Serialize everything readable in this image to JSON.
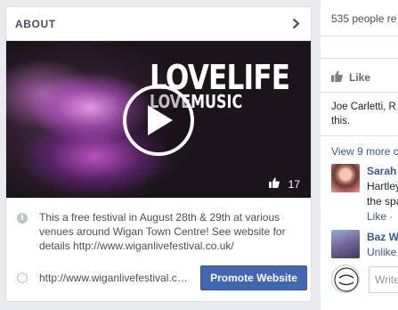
{
  "about": {
    "title": "ABOUT",
    "video": {
      "brand_line1": "LOVELIFE",
      "brand_line2": "LOVEMUSIC",
      "like_count": "17"
    },
    "description": "This a free festival in August 28th & 29th at various venues around Wigan Town Centre! See website for details http://www.wiganlivefestival.co.uk/",
    "website_url": "http://www.wiganlivefestival.co.uk/",
    "promote_label": "Promote Website"
  },
  "right_column": {
    "people_count_text": "535 people re",
    "like_label": "Like",
    "reactors_line1": "Joe Carletti, R",
    "reactors_line2": "this.",
    "view_more": "View 9 more c",
    "comments": [
      {
        "name": "Sarah",
        "line2": "Hartley",
        "line3": "the spa",
        "action": "Like ·"
      },
      {
        "name": "Baz W",
        "line2": "Unlike",
        "line3": "",
        "action": ""
      }
    ],
    "write_placeholder": "Write"
  },
  "colors": {
    "accent": "#4267b2",
    "link": "#385898",
    "background": "#e9ebee"
  }
}
